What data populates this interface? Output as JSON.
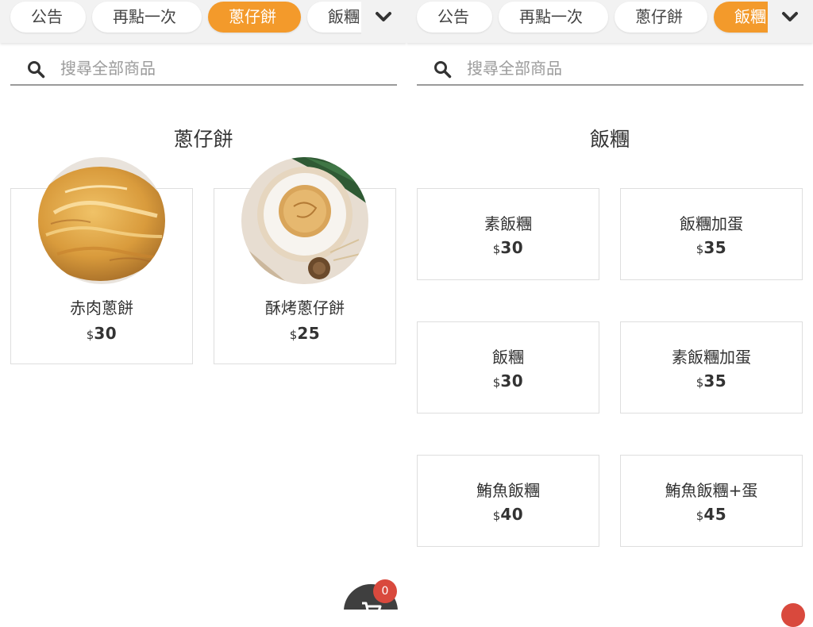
{
  "tabs": [
    "公告",
    "再點一次",
    "蔥仔餅",
    "飯糰"
  ],
  "search": {
    "placeholder": "搜尋全部商品"
  },
  "left": {
    "active_tab": "蔥仔餅",
    "section_title": "蔥仔餅",
    "products": [
      {
        "name": "赤肉蔥餅",
        "currency": "$",
        "price": "30"
      },
      {
        "name": "酥烤蔥仔餅",
        "currency": "$",
        "price": "25"
      }
    ],
    "cart_count": "0"
  },
  "right": {
    "active_tab": "飯糰",
    "section_title": "飯糰",
    "products": [
      {
        "name": "素飯糰",
        "currency": "$",
        "price": "30"
      },
      {
        "name": "飯糰加蛋",
        "currency": "$",
        "price": "35"
      },
      {
        "name": "飯糰",
        "currency": "$",
        "price": "30"
      },
      {
        "name": "素飯糰加蛋",
        "currency": "$",
        "price": "35"
      },
      {
        "name": "鮪魚飯糰",
        "currency": "$",
        "price": "40"
      },
      {
        "name": "鮪魚飯糰+蛋",
        "currency": "$",
        "price": "45"
      }
    ]
  },
  "colors": {
    "accent": "#f39a2b",
    "badge": "#d9493d",
    "cart": "#3f3f3f"
  },
  "icons": [
    "search-icon",
    "chevron-down-icon",
    "cart-icon"
  ]
}
